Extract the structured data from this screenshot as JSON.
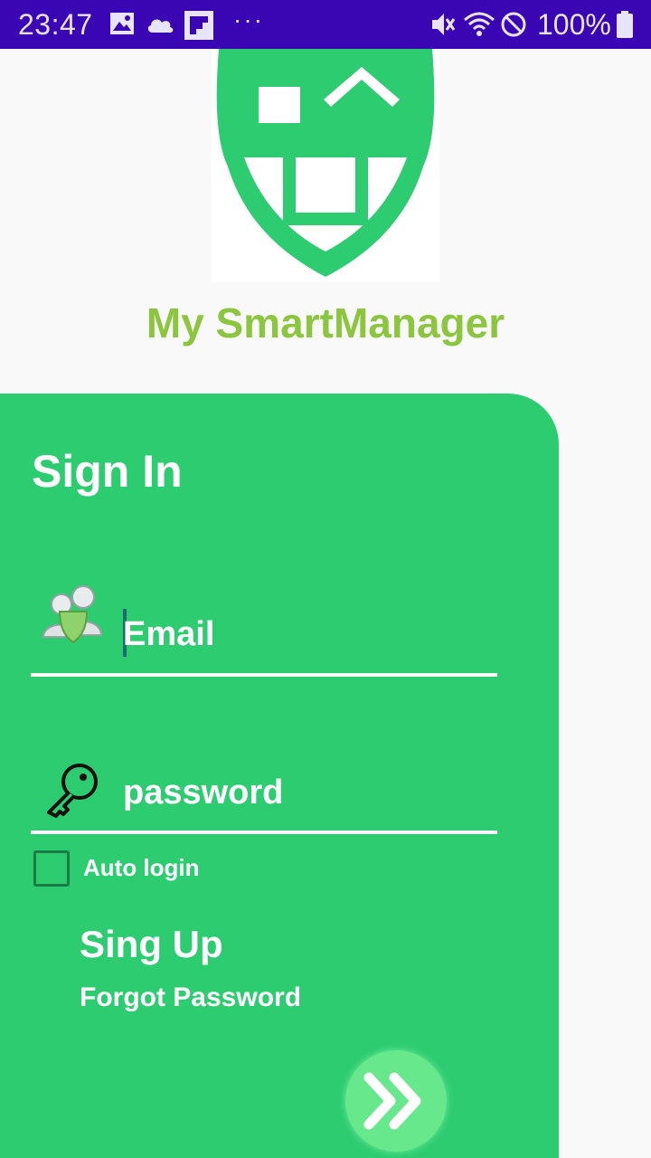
{
  "status_bar": {
    "time": "23:47",
    "battery": "100%",
    "icons": [
      "image-icon",
      "cloud-icon",
      "flipboard-icon",
      "more-dots-icon",
      "mute-icon",
      "wifi-icon",
      "do-not-disturb-icon",
      "battery-icon"
    ]
  },
  "app": {
    "title": "My SmartManager",
    "logo": "shield-house-logo",
    "brand_color": "#2ecc71",
    "title_color": "#8cc63f"
  },
  "form": {
    "heading": "Sign In",
    "email_placeholder": "Email",
    "email_icon": "users-shield-icon",
    "password_placeholder": "password",
    "password_icon": "key-icon",
    "auto_login_label": "Auto login",
    "auto_login_checked": false,
    "sign_up_label": "Sing Up",
    "forgot_password_label": "Forgot Password",
    "submit_icon": "double-chevron-right-icon"
  }
}
